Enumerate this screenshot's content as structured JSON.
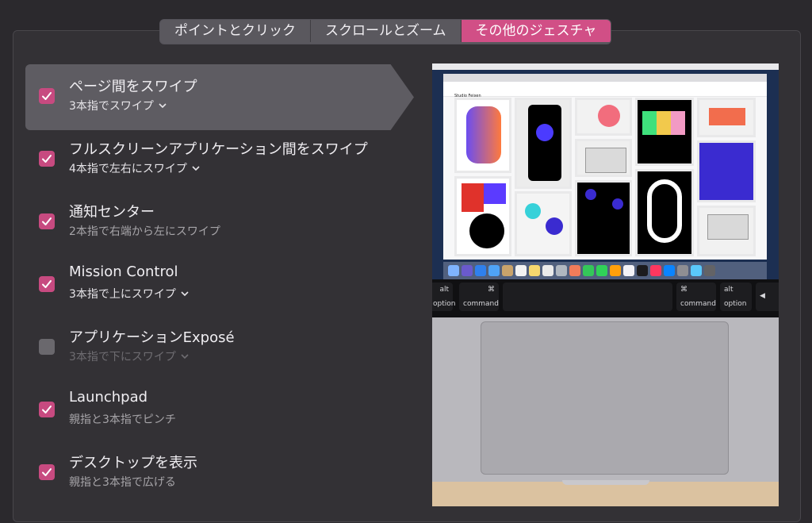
{
  "tabs": [
    {
      "label": "ポイントとクリック",
      "active": false
    },
    {
      "label": "スクロールとズーム",
      "active": false
    },
    {
      "label": "その他のジェスチャ",
      "active": true
    }
  ],
  "gestures": [
    {
      "title": "ページ間をスワイプ",
      "subtitle": "3本指でスワイプ",
      "checked": true,
      "has_menu": true,
      "selected": true
    },
    {
      "title": "フルスクリーンアプリケーション間をスワイプ",
      "subtitle": "4本指で左右にスワイプ",
      "checked": true,
      "has_menu": true
    },
    {
      "title": "通知センター",
      "subtitle": "2本指で右端から左にスワイプ",
      "checked": true,
      "has_menu": false
    },
    {
      "title": "Mission Control",
      "subtitle": "3本指で上にスワイプ",
      "checked": true,
      "has_menu": true
    },
    {
      "title": "アプリケーションExposé",
      "subtitle": "3本指で下にスワイプ",
      "checked": false,
      "has_menu": true,
      "disabled": true
    },
    {
      "title": "Launchpad",
      "subtitle": "親指と3本指でピンチ",
      "checked": true,
      "has_menu": false
    },
    {
      "title": "デスクトップを表示",
      "subtitle": "親指と3本指で広げる",
      "checked": true,
      "has_menu": false
    }
  ],
  "preview": {
    "site_title": "Studio Feixen",
    "keys": {
      "left_alt": "alt",
      "left_option": "option",
      "left_cmd_symbol": "⌘",
      "left_command": "command",
      "right_cmd_symbol": "⌘",
      "right_command": "command",
      "right_alt": "alt",
      "right_option": "option",
      "arrow": "◀"
    }
  },
  "colors": {
    "accent": "#d14f86",
    "background": "#2b292d",
    "selected_row": "#5e5c62"
  }
}
